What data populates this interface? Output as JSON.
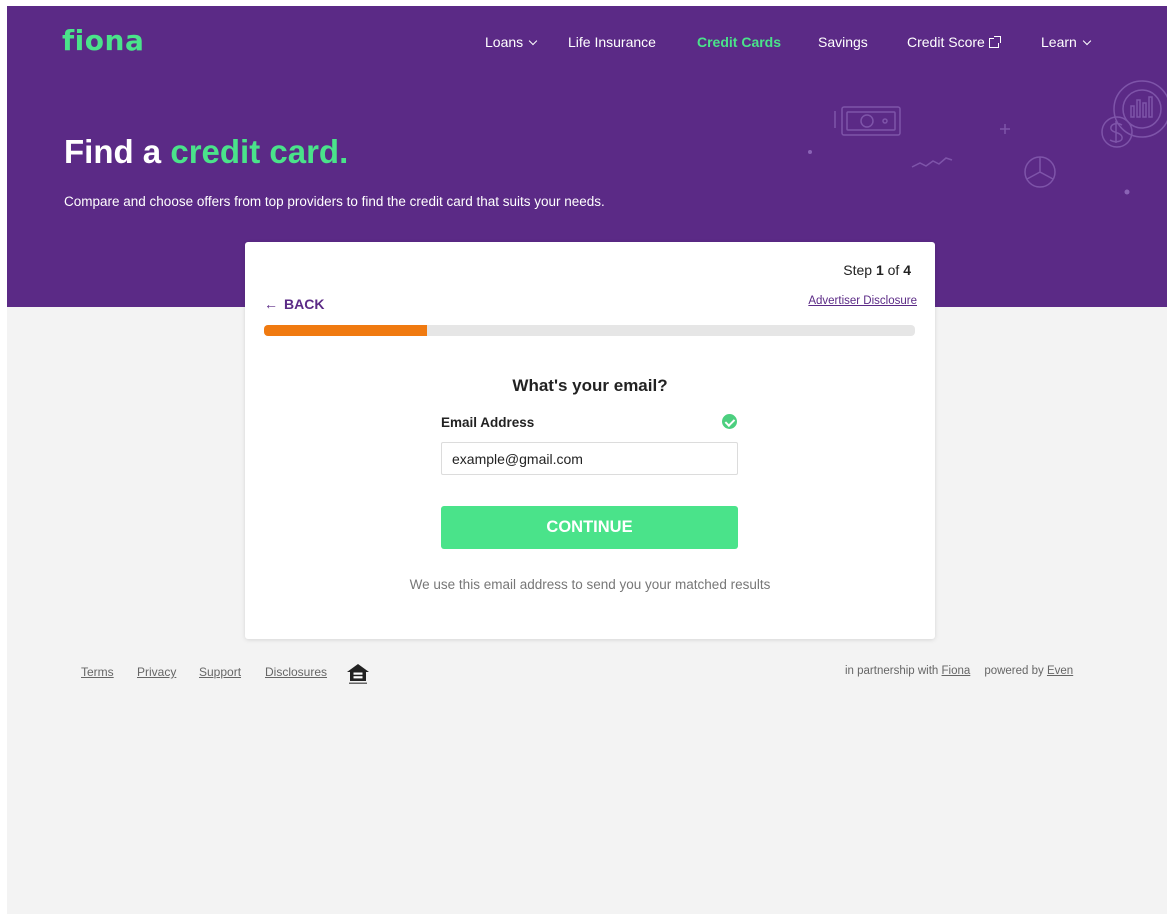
{
  "brand": {
    "logo": "fiona"
  },
  "nav": {
    "items": [
      {
        "label": "Loans",
        "dropdown": true
      },
      {
        "label": "Life Insurance"
      },
      {
        "label": "Credit Cards",
        "active": true
      },
      {
        "label": "Savings"
      },
      {
        "label": "Credit Score",
        "external": true
      },
      {
        "label": "Learn",
        "dropdown": true
      }
    ]
  },
  "hero": {
    "title_prefix": "Find a ",
    "title_accent": "credit card.",
    "subtitle": "Compare and choose offers from top providers to find the credit card that suits your needs."
  },
  "form": {
    "step_prefix": "Step ",
    "step_current": "1",
    "step_of": " of ",
    "step_total": "4",
    "progress_fraction": 0.25,
    "back_label": "BACK",
    "disclosure_label": "Advertiser Disclosure",
    "question": "What's your email?",
    "email_label": "Email Address",
    "email_value": "example@gmail.com",
    "email_valid": true,
    "continue_label": "CONTINUE",
    "note": "We use this email address to send you your matched results"
  },
  "footer": {
    "links": [
      "Terms",
      "Privacy",
      "Support",
      "Disclosures"
    ],
    "partnership_prefix": "in partnership with ",
    "partner_name": "Fiona",
    "powered_prefix": "powered by ",
    "powered_name": "Even"
  },
  "colors": {
    "brand_purple": "#5b2a86",
    "accent_green": "#4ae38a",
    "progress_orange": "#f07a10",
    "page_bg": "#f3f3f3"
  },
  "icons": [
    "chevron-down-icon",
    "external-link-icon",
    "arrow-left-icon",
    "check-circle-icon",
    "equal-housing-lender-icon"
  ]
}
